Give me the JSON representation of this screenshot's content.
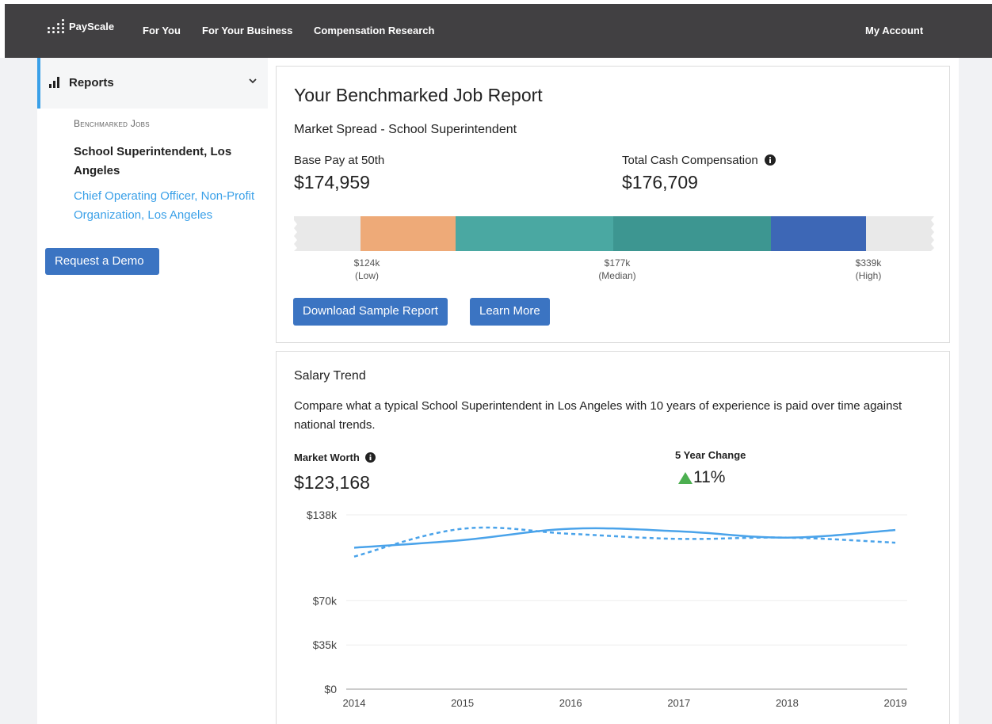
{
  "nav": {
    "logo_text": "PayScale",
    "links": [
      "For You",
      "For Your Business",
      "Compensation Research"
    ],
    "account": "My Account"
  },
  "sidebar": {
    "reports_label": "Reports",
    "section_label": "Benchmarked Jobs",
    "active_job": "School Superintendent, Los Angeles",
    "other_job": "Chief Operating Officer, Non-Profit Organization, Los Angeles",
    "demo_button": "Request a Demo"
  },
  "report": {
    "title": "Your Benchmarked Job Report",
    "subtitle": "Market Spread - School Superintendent",
    "base_pay_label": "Base Pay at 50th",
    "base_pay_value": "$174,959",
    "total_cash_label": "Total Cash Compensation",
    "total_cash_value": "$176,709",
    "spread_labels": [
      {
        "value": "$124k",
        "note": "(Low)"
      },
      {
        "value": "$177k",
        "note": "(Median)"
      },
      {
        "value": "$339k",
        "note": "(High)"
      }
    ],
    "spread_colors": [
      "#eeaa78",
      "#4aa8a2",
      "#3d9691",
      "#3d67b6"
    ],
    "download_button": "Download Sample Report",
    "learn_button": "Learn More"
  },
  "trend": {
    "title": "Salary Trend",
    "description": "Compare what a typical School Superintendent in Los Angeles with 10 years of experience is paid over time against national trends.",
    "market_worth_label": "Market Worth",
    "market_worth_value": "$123,168",
    "change_label": "5 Year Change",
    "change_value": "11%",
    "change_color": "#4caf50"
  },
  "chart_data": {
    "type": "line",
    "x": [
      2014,
      2015,
      2016,
      2017,
      2018,
      2019
    ],
    "y_ticks": [
      "$0",
      "$35k",
      "$70k",
      "$138k"
    ],
    "ylim": [
      0,
      138000
    ],
    "series": [
      {
        "style": "solid",
        "color": "#4aa3ea",
        "values": [
          112000,
          118000,
          127000,
          125000,
          120000,
          126000
        ]
      },
      {
        "style": "dashed",
        "color": "#4aa3ea",
        "values": [
          105000,
          127000,
          123000,
          119000,
          120000,
          116000
        ]
      }
    ],
    "grid": true
  }
}
